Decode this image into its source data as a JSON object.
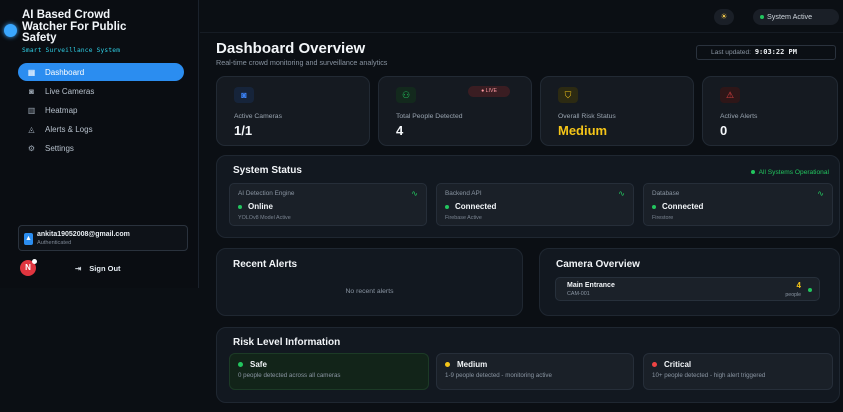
{
  "brand": {
    "title_lines": [
      "AI Based Crowd",
      "Watcher For Public",
      "Safety"
    ],
    "subtitle": "Smart Surveillance System"
  },
  "nav": [
    {
      "label": "Dashboard",
      "icon": "grid-icon",
      "active": true
    },
    {
      "label": "Live Cameras",
      "icon": "camera-icon",
      "active": false
    },
    {
      "label": "Heatmap",
      "icon": "map-icon",
      "active": false
    },
    {
      "label": "Alerts & Logs",
      "icon": "bell-icon",
      "active": false
    },
    {
      "label": "Settings",
      "icon": "gear-icon",
      "active": false
    }
  ],
  "user": {
    "email": "ankita19052008@gmail.com",
    "status": "Authenticated",
    "avatar_letter": "N"
  },
  "signout_label": "Sign Out",
  "topbar": {
    "status_label": "System Active"
  },
  "header": {
    "title": "Dashboard Overview",
    "subtitle": "Real-time crowd monitoring and surveillance analytics",
    "updated_label": "Last updated:",
    "updated_time": "9:03:22 PM"
  },
  "stats": [
    {
      "label": "Active Cameras",
      "value": "1/1",
      "icon": "camera-icon",
      "icon_color": "#3b82f6",
      "icon_bg": "#16243a",
      "value_color": "#f4f7fa"
    },
    {
      "label": "Total People Detected",
      "value": "4",
      "icon": "users-icon",
      "icon_color": "#22c55e",
      "icon_bg": "#13291d",
      "value_color": "#f4f7fa",
      "badge": "LIVE"
    },
    {
      "label": "Overall Risk Status",
      "value": "Medium",
      "icon": "shield-icon",
      "icon_color": "#f5c518",
      "icon_bg": "#2c2a12",
      "value_color": "#f5c518"
    },
    {
      "label": "Active Alerts",
      "value": "0",
      "icon": "warning-icon",
      "icon_color": "#ef4444",
      "icon_bg": "#2e1618",
      "value_color": "#f4f7fa"
    }
  ],
  "system_status": {
    "title": "System Status",
    "overall": "All Systems Operational",
    "items": [
      {
        "name": "AI Detection Engine",
        "status": "Online",
        "detail": "YOLOv8 Model Active"
      },
      {
        "name": "Backend API",
        "status": "Connected",
        "detail": "Firebase Active"
      },
      {
        "name": "Database",
        "status": "Connected",
        "detail": "Firestore"
      }
    ]
  },
  "recent_alerts": {
    "title": "Recent Alerts",
    "empty": "No recent alerts"
  },
  "camera_overview": {
    "title": "Camera Overview",
    "cameras": [
      {
        "name": "Main Entrance",
        "id": "CAM-001",
        "count": "4",
        "unit": "people"
      }
    ]
  },
  "risk_info": {
    "title": "Risk Level Information",
    "levels": [
      {
        "name": "Safe",
        "desc": "0 people detected across all cameras",
        "color": "#22c55e"
      },
      {
        "name": "Medium",
        "desc": "1-9 people detected - monitoring active",
        "color": "#f5c518"
      },
      {
        "name": "Critical",
        "desc": "10+ people detected - high alert triggered",
        "color": "#ef4444"
      }
    ]
  },
  "colors": {
    "accent": "#2b8df0",
    "ok": "#22c55e",
    "warn": "#f5c518",
    "danger": "#ef4444"
  }
}
